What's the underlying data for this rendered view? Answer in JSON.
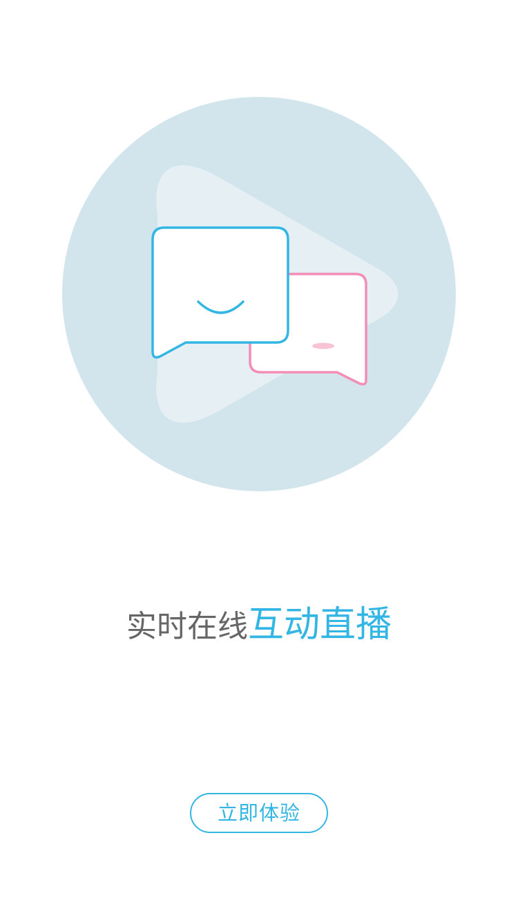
{
  "colors": {
    "accent": "#33b6e3",
    "pink": "#f48db6",
    "blush": "#f9c3d6",
    "circle_bg": "#d2e5ec",
    "play_shape": "#e6f0f4",
    "text_gray": "#666666",
    "background": "#ffffff"
  },
  "hero": {
    "icon": "chat-bubbles-on-play-icon"
  },
  "headline": {
    "plain": "实时在线",
    "accent": "互动直播"
  },
  "cta": {
    "label": "立即体验"
  }
}
